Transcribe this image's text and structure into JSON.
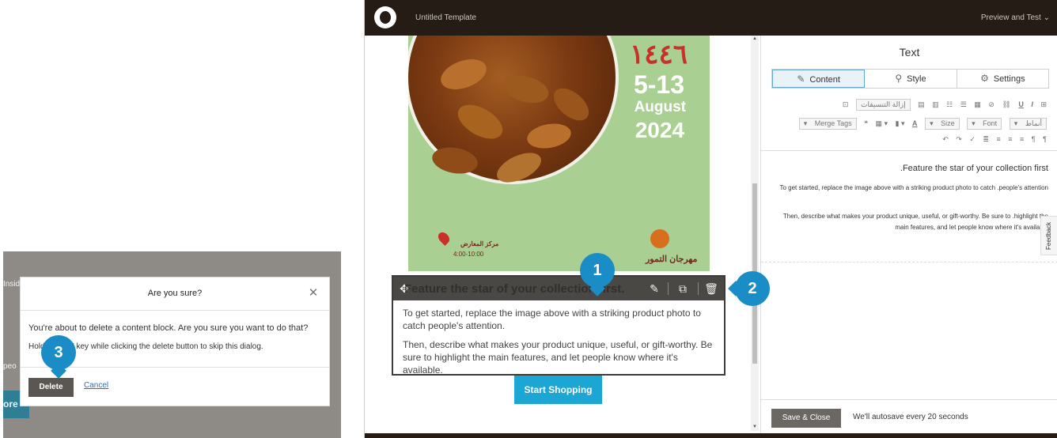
{
  "dialog": {
    "title": "Are you sure?",
    "close_icon": "close-icon",
    "message": "You're about to delete a content block. Are you sure you want to do that?",
    "hint": "Hold the \"alt\" key while clicking the delete button to skip this dialog.",
    "delete_label": "Delete",
    "cancel_label": "Cancel",
    "bg_text_1": "Inside",
    "bg_text_2": "peo",
    "bg_button_label": "ore"
  },
  "markers": [
    "1",
    "2",
    "3"
  ],
  "editor": {
    "template_title": "Untitled Template",
    "preview_label": "Preview and Test",
    "poster": {
      "arabic_year": "١٤٤٦",
      "days": "5-13",
      "month": "August",
      "year": "2024",
      "location": "مركز المعارض",
      "hours": "4:00-10:00",
      "festival": "مهرجان التمور"
    },
    "block": {
      "heading": "Feature the star of your collection first.",
      "p1": "To get started, replace the image above with a striking product photo to catch people's attention.",
      "p2": "Then, describe what makes your product unique, useful, or gift-worthy. Be sure to highlight the main features, and let people know where it's available."
    },
    "shop_button": "Start Shopping"
  },
  "panel": {
    "title": "Text",
    "tabs": [
      {
        "label": "Content",
        "icon": "edit-icon"
      },
      {
        "label": "Style",
        "icon": "brush-icon"
      },
      {
        "label": "Settings",
        "icon": "gear-icon"
      }
    ],
    "toolbar": {
      "clear_formatting": "إزالة التنسيقات",
      "merge_tags": "Merge Tags",
      "size": "Size",
      "font": "Font",
      "format": "أنماط"
    },
    "rte_heading": ".Feature the star of your collection first",
    "rte_p1": "To get started, replace the image above with a striking product photo to catch .people's attention",
    "rte_p2": "Then, describe what makes your product unique, useful, or gift-worthy. Be sure to .highlight the main features, and let people know where it's available",
    "feedback": "Feedback",
    "save_label": "Save & Close",
    "autosave": "We'll autosave every 20 seconds"
  }
}
